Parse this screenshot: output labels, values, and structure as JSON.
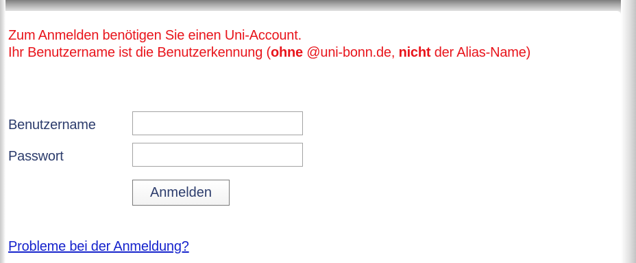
{
  "notice": {
    "line1": "Zum Anmelden benötigen Sie einen Uni-Account.",
    "line2_part1": "Ihr Benutzername ist die Benutzerkennung (",
    "line2_bold1": "ohne",
    "line2_part2": " @uni-bonn.de, ",
    "line2_bold2": "nicht",
    "line2_part3": " der Alias-Name)"
  },
  "form": {
    "username_label": "Benutzername",
    "username_value": "",
    "password_label": "Passwort",
    "password_value": "",
    "submit_label": "Anmelden"
  },
  "help": {
    "link_text": "Probleme bei der Anmeldung?"
  },
  "colors": {
    "notice": "#e8141b",
    "label": "#2c3c6c",
    "link": "#1522cc"
  }
}
